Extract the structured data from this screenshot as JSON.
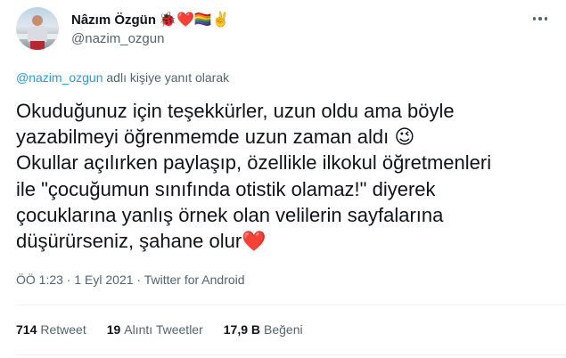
{
  "author": {
    "display_name": "Nâzım Özgün",
    "badges": "🐞❤️🏳️‍🌈✌️",
    "handle": "@nazim_ozgun"
  },
  "icons": {
    "more": "more-horizontal-icon",
    "avatar": "avatar-photo"
  },
  "reply_context": {
    "mention": "@nazim_ozgun",
    "suffix": " adlı kişiye yanıt olarak"
  },
  "tweet": {
    "text": "Okuduğunuz için teşekkürler, uzun oldu ama böyle\nyazabilmeyi öğrenmemde uzun zaman aldı 😉\nOkullar açılırken paylaşıp, özellikle ilkokul öğretmenleri\nile \"çocuğumun sınıfında otistik olamaz!\" diyerek\nçocuklarına yanlış örnek olan velilerin sayfalarına\ndüşürürseniz, şahane olur❤️",
    "meta": "ÖÖ 1:23 · 1 Eyl 2021 · Twitter for Android"
  },
  "stats": {
    "retweets_count": "714",
    "retweets_label": "Retweet",
    "quotes_count": "19",
    "quotes_label": "Alıntı Tweetler",
    "likes_count": "17,9 B",
    "likes_label": "Beğeni"
  },
  "colors": {
    "text_primary": "#0f1419",
    "text_secondary": "#536471",
    "link": "#1d9bf0",
    "divider": "#eff3f4"
  }
}
